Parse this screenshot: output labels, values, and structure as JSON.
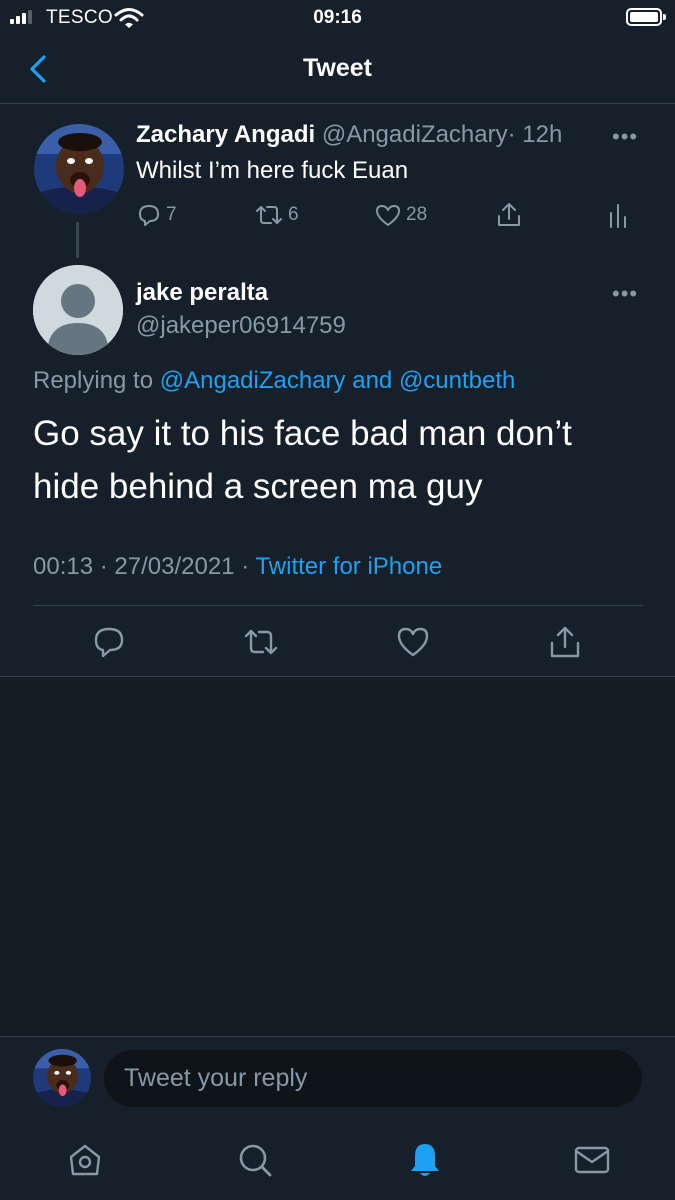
{
  "status_bar": {
    "carrier": "TESCO",
    "time": "09:16"
  },
  "nav": {
    "title": "Tweet"
  },
  "parent_tweet": {
    "name": "Zachary Angadi",
    "handle": "@AngadiZachary",
    "age": "· 12h",
    "more": "•••",
    "text": "Whilst I’m here fuck Euan",
    "replies": "7",
    "retweets": "6",
    "likes": "28"
  },
  "main_tweet": {
    "name": "jake peralta",
    "handle": "@jakeper06914759",
    "more": "•••",
    "replying_prefix": "Replying to",
    "replying_user1": "@AngadiZachary",
    "replying_and": "and",
    "replying_user2": "@cuntbeth",
    "text": "Go say it to his face bad man don’t hide behind a screen ma guy",
    "time": "00:13",
    "dot1": "·",
    "date": "27/03/2021",
    "dot2": "·",
    "source": "Twitter for iPhone"
  },
  "reply_bar": {
    "placeholder": "Tweet your reply"
  },
  "colors": {
    "background": "#15202b",
    "accent": "#1da1f2",
    "secondary_text": "#8899a6",
    "divider": "#38444d"
  },
  "icons": {
    "status": [
      "signal-icon",
      "wifi-icon",
      "battery-icon"
    ],
    "nav": [
      "back-chevron-icon"
    ],
    "tweet_actions": [
      "reply-icon",
      "retweet-icon",
      "like-icon",
      "share-icon",
      "analytics-icon"
    ],
    "tabs": [
      "home-icon",
      "search-icon",
      "notifications-icon",
      "messages-icon"
    ],
    "active_tab": "notifications"
  }
}
